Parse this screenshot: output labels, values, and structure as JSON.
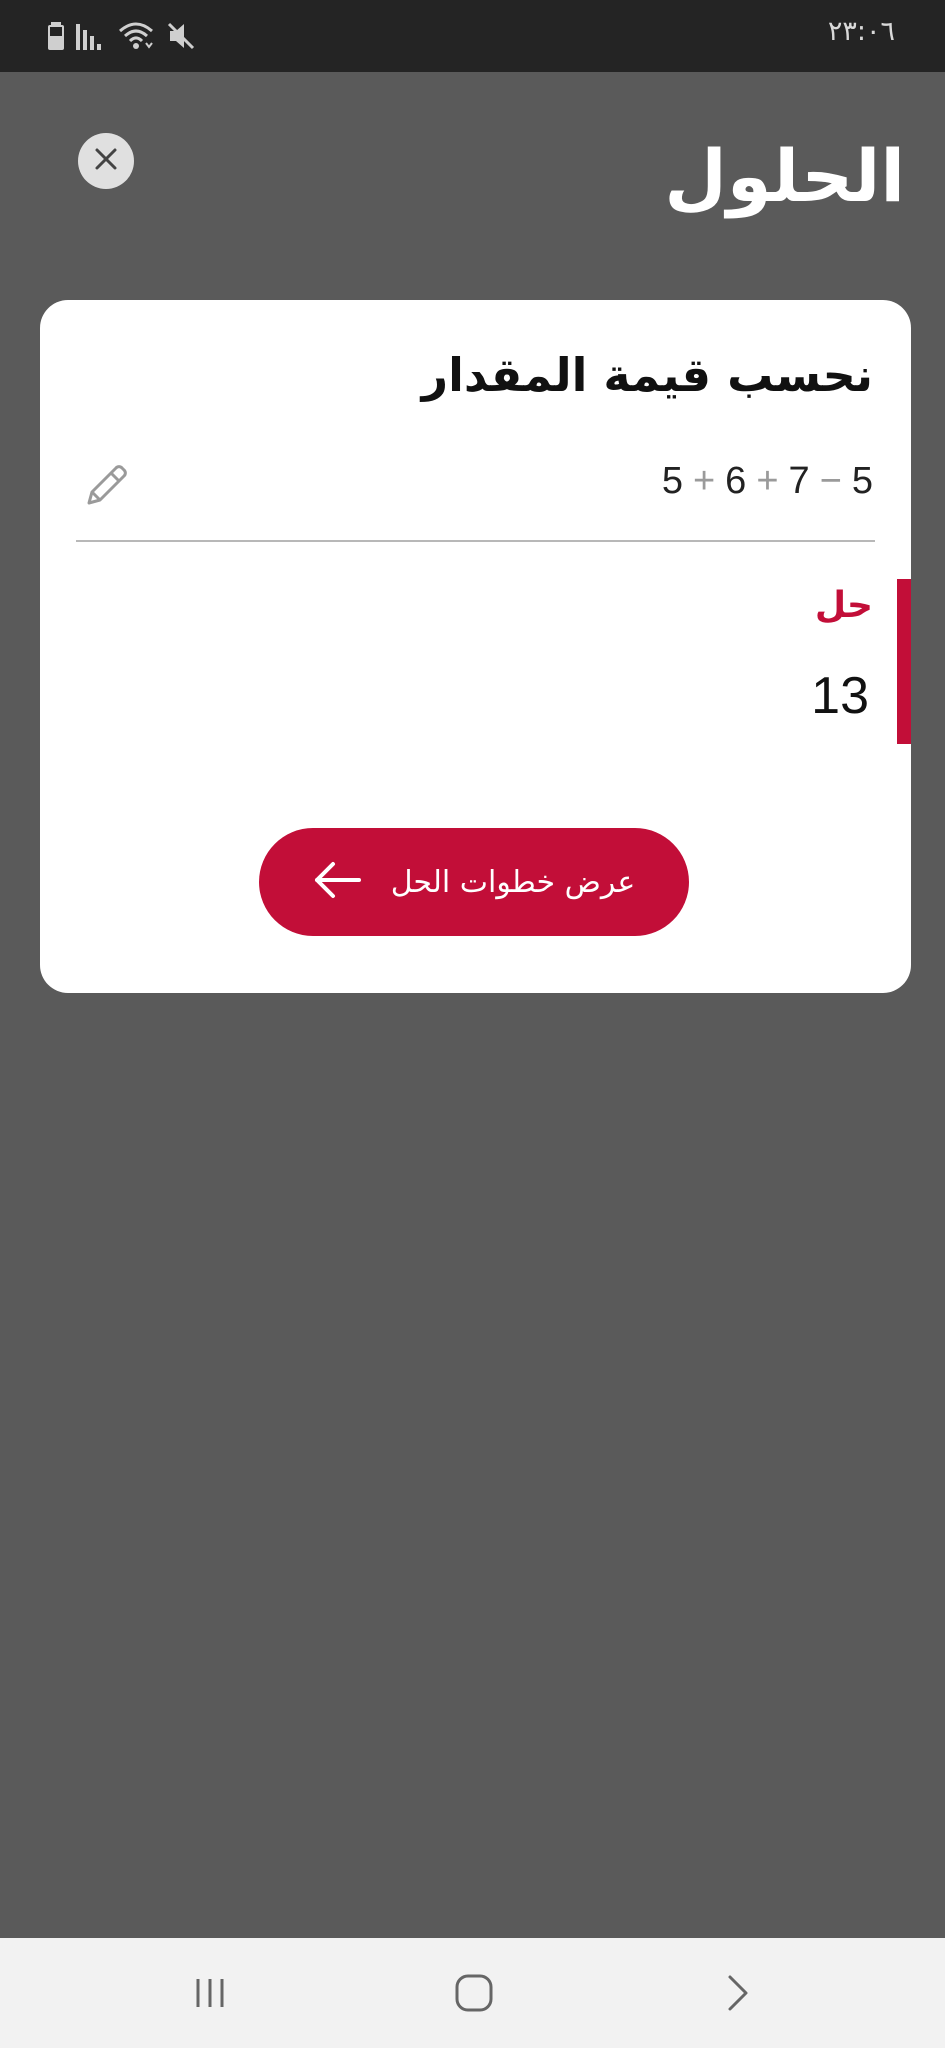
{
  "status_bar": {
    "time": "٢٣:٠٦",
    "icons": [
      "battery-icon",
      "signal-icon",
      "wifi-icon",
      "mute-icon"
    ]
  },
  "header": {
    "title": "الحلول",
    "close_icon": "close-icon"
  },
  "card": {
    "title": "نحسب قيمة المقدار",
    "expression": {
      "tokens": [
        {
          "text": "5",
          "kind": "num"
        },
        {
          "text": "+",
          "kind": "op"
        },
        {
          "text": "6",
          "kind": "num"
        },
        {
          "text": "+",
          "kind": "op"
        },
        {
          "text": "7",
          "kind": "num"
        },
        {
          "text": "−",
          "kind": "op"
        },
        {
          "text": "5",
          "kind": "num"
        }
      ],
      "edit_icon": "pencil-icon"
    },
    "solution": {
      "label": "حل",
      "value": "13"
    },
    "steps_button": {
      "label": "عرض خطوات الحل",
      "icon": "arrow-left-icon"
    }
  },
  "nav_bar": {
    "items": [
      "recent-apps-icon",
      "home-icon",
      "back-icon"
    ]
  },
  "colors": {
    "accent": "#c20e38",
    "background": "#5a5a5a",
    "status_bar": "#242424",
    "card": "#ffffff"
  }
}
